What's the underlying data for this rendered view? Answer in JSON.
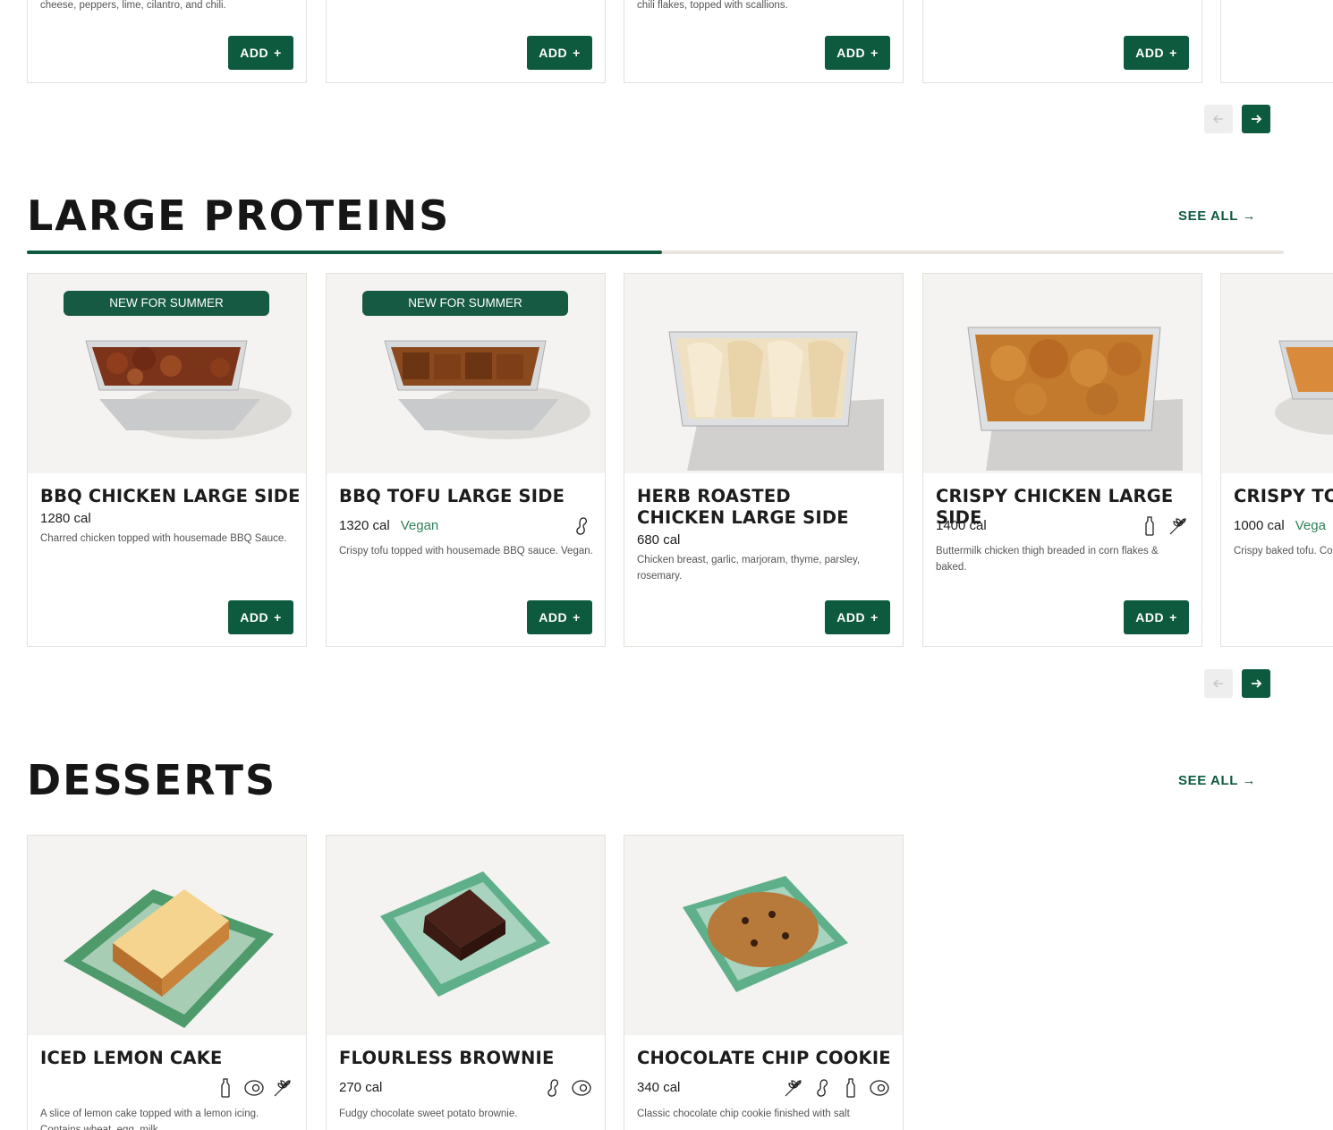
{
  "top_row": {
    "descriptions": [
      "cheese, peppers, lime, cilantro, and chili.",
      "",
      "chili flakes, topped with scallions.",
      ""
    ],
    "add_label": "ADD",
    "add_plus": "+"
  },
  "large_proteins": {
    "title": "LARGE PROTEINS",
    "see_all": "SEE ALL →",
    "scroll_progress_fraction": 0.505,
    "items": [
      {
        "badge": "NEW FOR SUMMER",
        "name": "BBQ CHICKEN LARGE SIDE",
        "cal": "1280 cal",
        "tag": "",
        "desc": "Charred chicken topped with housemade BBQ Sauce.",
        "icons": [],
        "add": "ADD"
      },
      {
        "badge": "NEW FOR SUMMER",
        "name": "BBQ TOFU LARGE SIDE",
        "cal": "1320 cal",
        "tag": "Vegan",
        "desc": "Crispy tofu topped with housemade BBQ sauce. Vegan.",
        "icons": [
          "peanut-icon"
        ],
        "add": "ADD"
      },
      {
        "badge": "",
        "name": "HERB ROASTED CHICKEN LARGE SIDE",
        "cal": "680 cal",
        "tag": "",
        "desc": "Chicken breast, garlic, marjoram, thyme, parsley, rosemary.",
        "icons": [],
        "add": "ADD"
      },
      {
        "badge": "",
        "name": "CRISPY CHICKEN LARGE SIDE",
        "cal": "1400 cal",
        "tag": "",
        "desc": "Buttermilk chicken thigh breaded in corn flakes & baked.",
        "icons": [
          "milk-icon",
          "wheat-icon"
        ],
        "add": "ADD"
      },
      {
        "badge": "",
        "name": "CRISPY TOF",
        "cal": "1000 cal",
        "tag": "Vega",
        "desc": "Crispy baked tofu. Co",
        "icons": [],
        "add": ""
      }
    ]
  },
  "desserts": {
    "title": "DESSERTS",
    "see_all": "SEE ALL →",
    "items": [
      {
        "name": "ICED LEMON CAKE",
        "cal": "",
        "desc": "A slice of lemon cake topped with a lemon icing. Contains wheat, egg, milk.",
        "icons": [
          "milk-icon",
          "egg-icon",
          "wheat-icon"
        ]
      },
      {
        "name": "FLOURLESS BROWNIE",
        "cal": "270 cal",
        "desc": "Fudgy chocolate sweet potato brownie.",
        "icons": [
          "peanut-icon",
          "egg-icon"
        ]
      },
      {
        "name": "CHOCOLATE CHIP COOKIE",
        "cal": "340 cal",
        "desc": "Classic chocolate chip cookie finished with salt",
        "icons": [
          "wheat-icon",
          "peanut-icon",
          "milk-icon",
          "egg-icon"
        ]
      }
    ]
  },
  "colors": {
    "brand_green": "#0e5a3f",
    "badge_green": "#165a43",
    "vegan_green": "#2f8158",
    "image_bg": "#f4f3f1"
  }
}
